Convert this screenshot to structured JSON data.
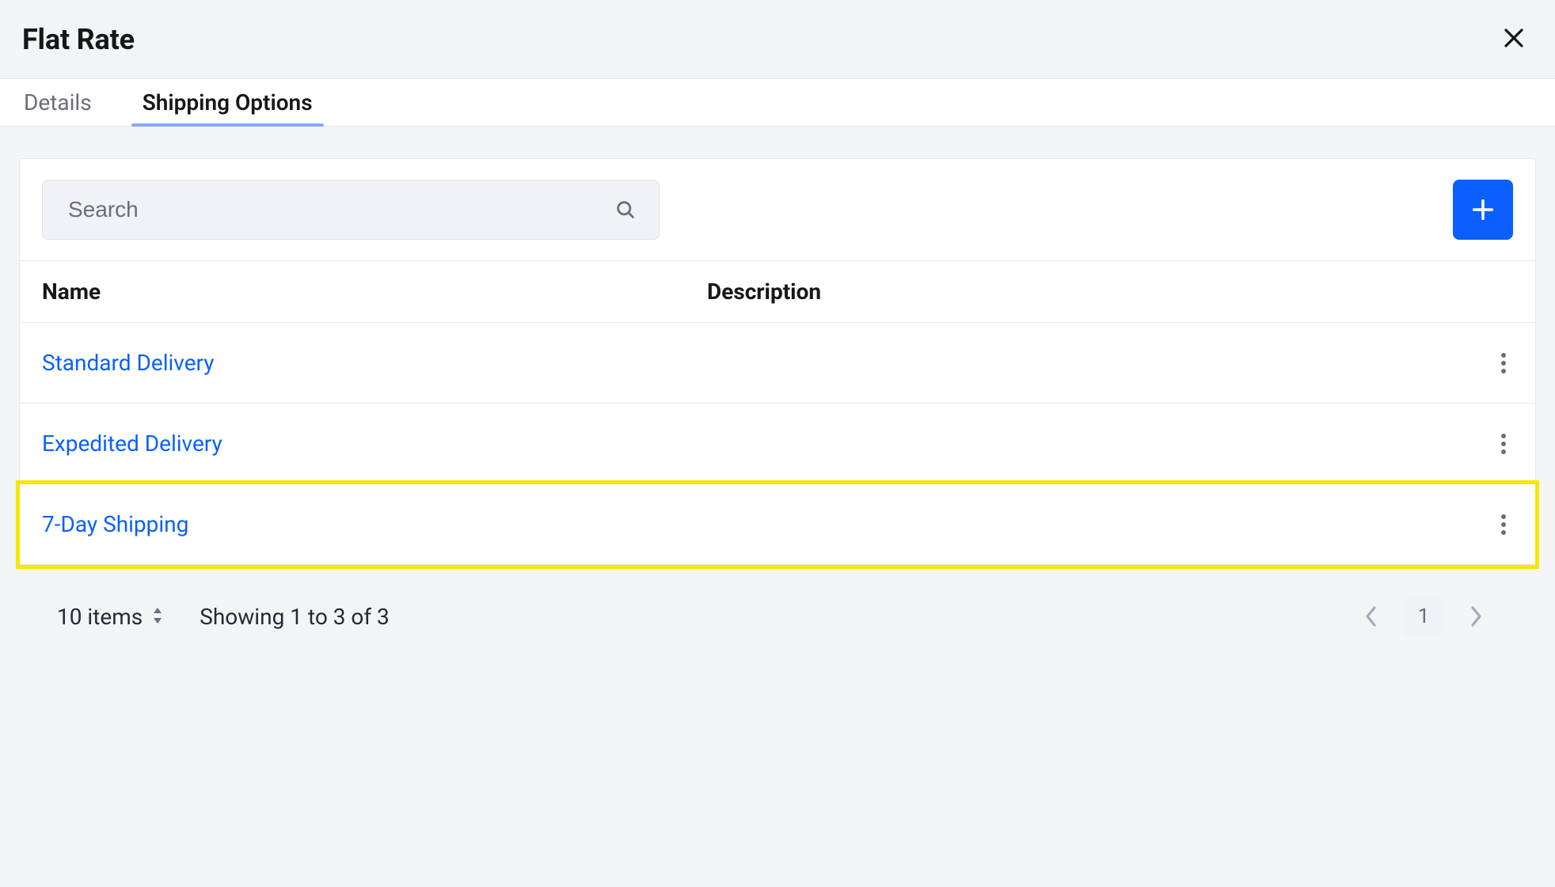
{
  "header": {
    "title": "Flat Rate"
  },
  "tabs": [
    {
      "label": "Details",
      "active": false
    },
    {
      "label": "Shipping Options",
      "active": true
    }
  ],
  "toolbar": {
    "search_placeholder": "Search"
  },
  "table": {
    "columns": {
      "name": "Name",
      "description": "Description"
    },
    "rows": [
      {
        "name": "Standard Delivery",
        "description": "",
        "highlighted": false
      },
      {
        "name": "Expedited Delivery",
        "description": "",
        "highlighted": false
      },
      {
        "name": "7-Day Shipping",
        "description": "",
        "highlighted": true
      }
    ]
  },
  "footer": {
    "page_size_label": "10 items",
    "page_range_label": "Showing 1 to 3 of 3",
    "current_page": "1"
  }
}
